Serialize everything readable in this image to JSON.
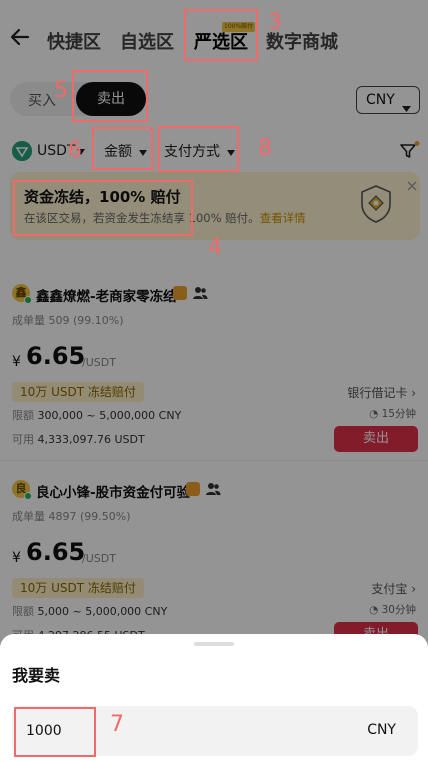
{
  "header": {
    "back_icon": "back-arrow-icon",
    "tabs": [
      {
        "label": "快捷区"
      },
      {
        "label": "自选区"
      },
      {
        "label": "严选区",
        "badge": "100%赔付"
      },
      {
        "label": "数字商城"
      }
    ]
  },
  "trade_mode": {
    "buy_label": "买入",
    "sell_label": "卖出",
    "selected": "卖出"
  },
  "currency_selector": {
    "value": "CNY",
    "icon": "chevron-down-icon"
  },
  "filters": {
    "coin": "USDT",
    "amount": "金额",
    "payment_method": "支付方式",
    "filter_icon": "funnel-icon"
  },
  "banner": {
    "title": "资金冻结，100% 赔付",
    "description": "在该区交易，若资金发生冻结享 100% 赔付。",
    "link": "查看详情",
    "icon": "shield-icon",
    "close_icon": "close-icon"
  },
  "listings": [
    {
      "avatar_char": "鑫",
      "merchant": "鑫鑫燎燃-老商家零冻结",
      "stat_label": "成单量",
      "stat_value": "509 (99.10%)",
      "price_symbol": "¥",
      "price": "6.65",
      "price_unit": "/USDT",
      "freeze_tag": "10万 USDT 冻结赔付",
      "limit_label": "限额",
      "limit_value": "300,000 ~ 5,000,000 CNY",
      "available_label": "可用",
      "available_value": "4,333,097.76 USDT",
      "payment": "银行借记卡",
      "time": "15分钟",
      "action": "卖出"
    },
    {
      "avatar_char": "良",
      "merchant": "良心小锋-股市资金付可验",
      "stat_label": "成单量",
      "stat_value": "4897 (99.50%)",
      "price_symbol": "¥",
      "price": "6.65",
      "price_unit": "/USDT",
      "freeze_tag": "10万 USDT 冻结赔付",
      "limit_label": "限额",
      "limit_value": "5,000 ~ 5,000,000 CNY",
      "available_label": "可用",
      "available_value": "4,297,286.55 USDT",
      "payment": "支付宝",
      "time": "30分钟",
      "action": "卖出"
    }
  ],
  "sheet": {
    "title": "我要卖",
    "amount_value": "1000",
    "amount_currency": "CNY"
  },
  "annotations": [
    "3",
    "4",
    "5",
    "6",
    "7",
    "8"
  ],
  "colors": {
    "accent_sell": "#e0314b",
    "annotation": "#f06a6a",
    "banner_bg": "#fdf3d3",
    "badge_gold": "#f5c842"
  }
}
